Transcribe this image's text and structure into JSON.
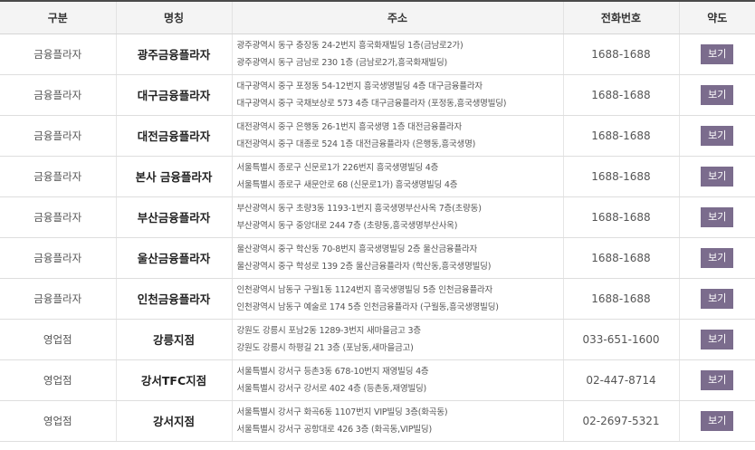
{
  "headers": {
    "category": "구분",
    "name": "명칭",
    "address": "주소",
    "phone": "전화번호",
    "map": "약도"
  },
  "rows": [
    {
      "category": "금융플라자",
      "name": "광주금융플라자",
      "address1": "광주광역시 동구 충장동 24-2번지 흥국화재빌딩 1층(금남로2가)",
      "address2": "광주광역시 동구 금남로 230 1층 (금남로2가,흥국화재빌딩)",
      "phone": "1688-1688",
      "button": "보기"
    },
    {
      "category": "금융플라자",
      "name": "대구금융플라자",
      "address1": "대구광역시 중구 포정동 54-12번지 흥국생명빌딩 4층 대구금융플라자",
      "address2": "대구광역시 중구 국채보상로 573 4층 대구금융플라자 (포정동,흥국생명빌딩)",
      "phone": "1688-1688",
      "button": "보기"
    },
    {
      "category": "금융플라자",
      "name": "대전금융플라자",
      "address1": "대전광역시 중구 은행동 26-1번지 흥국생명 1층 대전금융플라자",
      "address2": "대전광역시 중구 대종로 524 1층 대전금융플라자 (은행동,흥국생명)",
      "phone": "1688-1688",
      "button": "보기"
    },
    {
      "category": "금융플라자",
      "name": "본사 금융플라자",
      "address1": "서울특별시 종로구 신문로1가 226번지 흥국생명빌딩 4층",
      "address2": "서울특별시 종로구 새문안로 68 (신문로1가) 흥국생명빌딩 4층",
      "phone": "1688-1688",
      "button": "보기"
    },
    {
      "category": "금융플라자",
      "name": "부산금융플라자",
      "address1": "부산광역시 동구 초량3동 1193-1번지 흥국생명부산사옥 7층(초량동)",
      "address2": "부산광역시 동구 중앙대로 244 7층 (초량동,흥국생명부산사옥)",
      "phone": "1688-1688",
      "button": "보기"
    },
    {
      "category": "금융플라자",
      "name": "울산금융플라자",
      "address1": "울산광역시 중구 학산동 70-8번지 흥국생명빌딩 2층 울산금융플라자",
      "address2": "울산광역시 중구 학성로 139 2층 울산금융플라자 (학산동,흥국생명빌딩)",
      "phone": "1688-1688",
      "button": "보기"
    },
    {
      "category": "금융플라자",
      "name": "인천금융플라자",
      "address1": "인천광역시 남동구 구월1동 1124번지 흥국생명빌딩 5층 인천금융플라자",
      "address2": "인천광역시 남동구 예술로 174 5층 인천금융플라자 (구월동,흥국생명빌딩)",
      "phone": "1688-1688",
      "button": "보기"
    },
    {
      "category": "영업점",
      "name": "강릉지점",
      "address1": "강원도 강릉시 포남2동 1289-3번지 새마을금고 3층",
      "address2": "강원도 강릉시 하평길 21 3층 (포남동,새마을금고)",
      "phone": "033-651-1600",
      "button": "보기"
    },
    {
      "category": "영업점",
      "name": "강서TFC지점",
      "address1": "서울특별시 강서구 등촌3동 678-10번지 재영빌딩 4층",
      "address2": "서울특별시 강서구 강서로 402 4층 (등촌동,재영빌딩)",
      "phone": "02-447-8714",
      "button": "보기"
    },
    {
      "category": "영업점",
      "name": "강서지점",
      "address1": "서울특별시 강서구 화곡6동 1107번지 VIP빌딩 3층(화곡동)",
      "address2": "서울특별시 강서구 공항대로 426 3층 (화곡동,VIP빌딩)",
      "phone": "02-2697-5321",
      "button": "보기"
    }
  ]
}
